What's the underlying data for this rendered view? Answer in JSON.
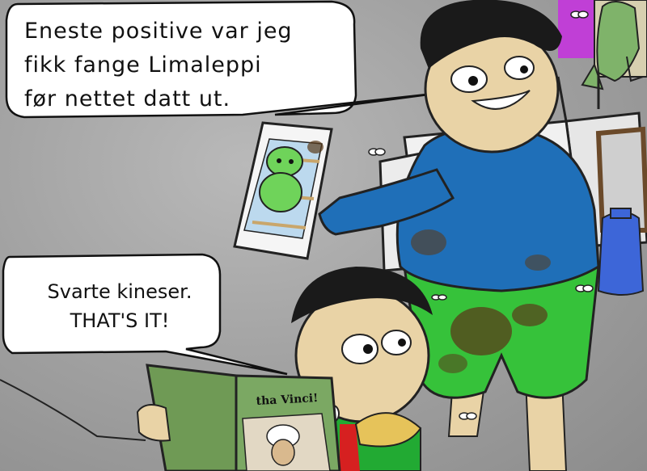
{
  "speech_top": {
    "lines": [
      "Eneste positive var jeg",
      "fikk fange Limaleppi",
      "før nettet datt ut."
    ]
  },
  "speech_left": {
    "lines": [
      "Svarte kineser.",
      "THAT'S IT!"
    ]
  },
  "book": {
    "title": "tha Vinci!"
  },
  "colors": {
    "background": "#a3a3a3",
    "shirt": "#1f6fb8",
    "shorts": "#36c23a",
    "skin": "#e9d3a6",
    "book": "#6f9a55",
    "phone_creature": "#6fd35a"
  }
}
